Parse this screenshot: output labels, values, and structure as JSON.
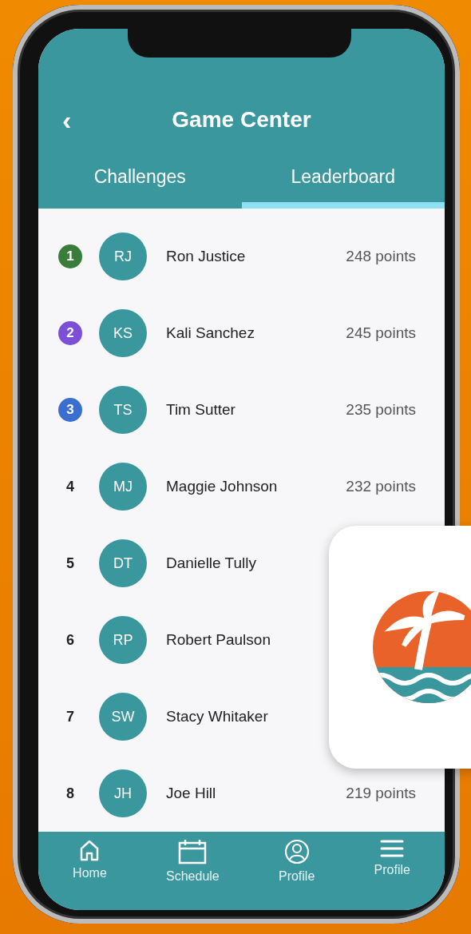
{
  "header": {
    "back": "‹",
    "title": "Game Center"
  },
  "tabs": [
    {
      "label": "Challenges",
      "selected": false
    },
    {
      "label": "Leaderboard",
      "selected": true
    }
  ],
  "leaderboard": [
    {
      "rank": "1",
      "kind": "badge",
      "color": "#3a7d3a",
      "initials": "RJ",
      "name": "Ron Justice",
      "points": "248 points"
    },
    {
      "rank": "2",
      "kind": "badge",
      "color": "#7b4fd6",
      "initials": "KS",
      "name": "Kali Sanchez",
      "points": "245 points"
    },
    {
      "rank": "3",
      "kind": "badge",
      "color": "#3a6fd0",
      "initials": "TS",
      "name": "Tim Sutter",
      "points": "235 points"
    },
    {
      "rank": "4",
      "kind": "plain",
      "initials": "MJ",
      "name": "Maggie Johnson",
      "points": "232 points"
    },
    {
      "rank": "5",
      "kind": "plain",
      "initials": "DT",
      "name": "Danielle Tully"
    },
    {
      "rank": "6",
      "kind": "plain",
      "initials": "RP",
      "name": "Robert Paulson"
    },
    {
      "rank": "7",
      "kind": "plain",
      "initials": "SW",
      "name": "Stacy Whitaker"
    },
    {
      "rank": "8",
      "kind": "plain",
      "initials": "JH",
      "name": "Joe Hill",
      "points": "219 points"
    }
  ],
  "bottom_nav": [
    {
      "label": "Home"
    },
    {
      "label": "Schedule"
    },
    {
      "label": "Profile"
    },
    {
      "label": "Profile"
    }
  ]
}
